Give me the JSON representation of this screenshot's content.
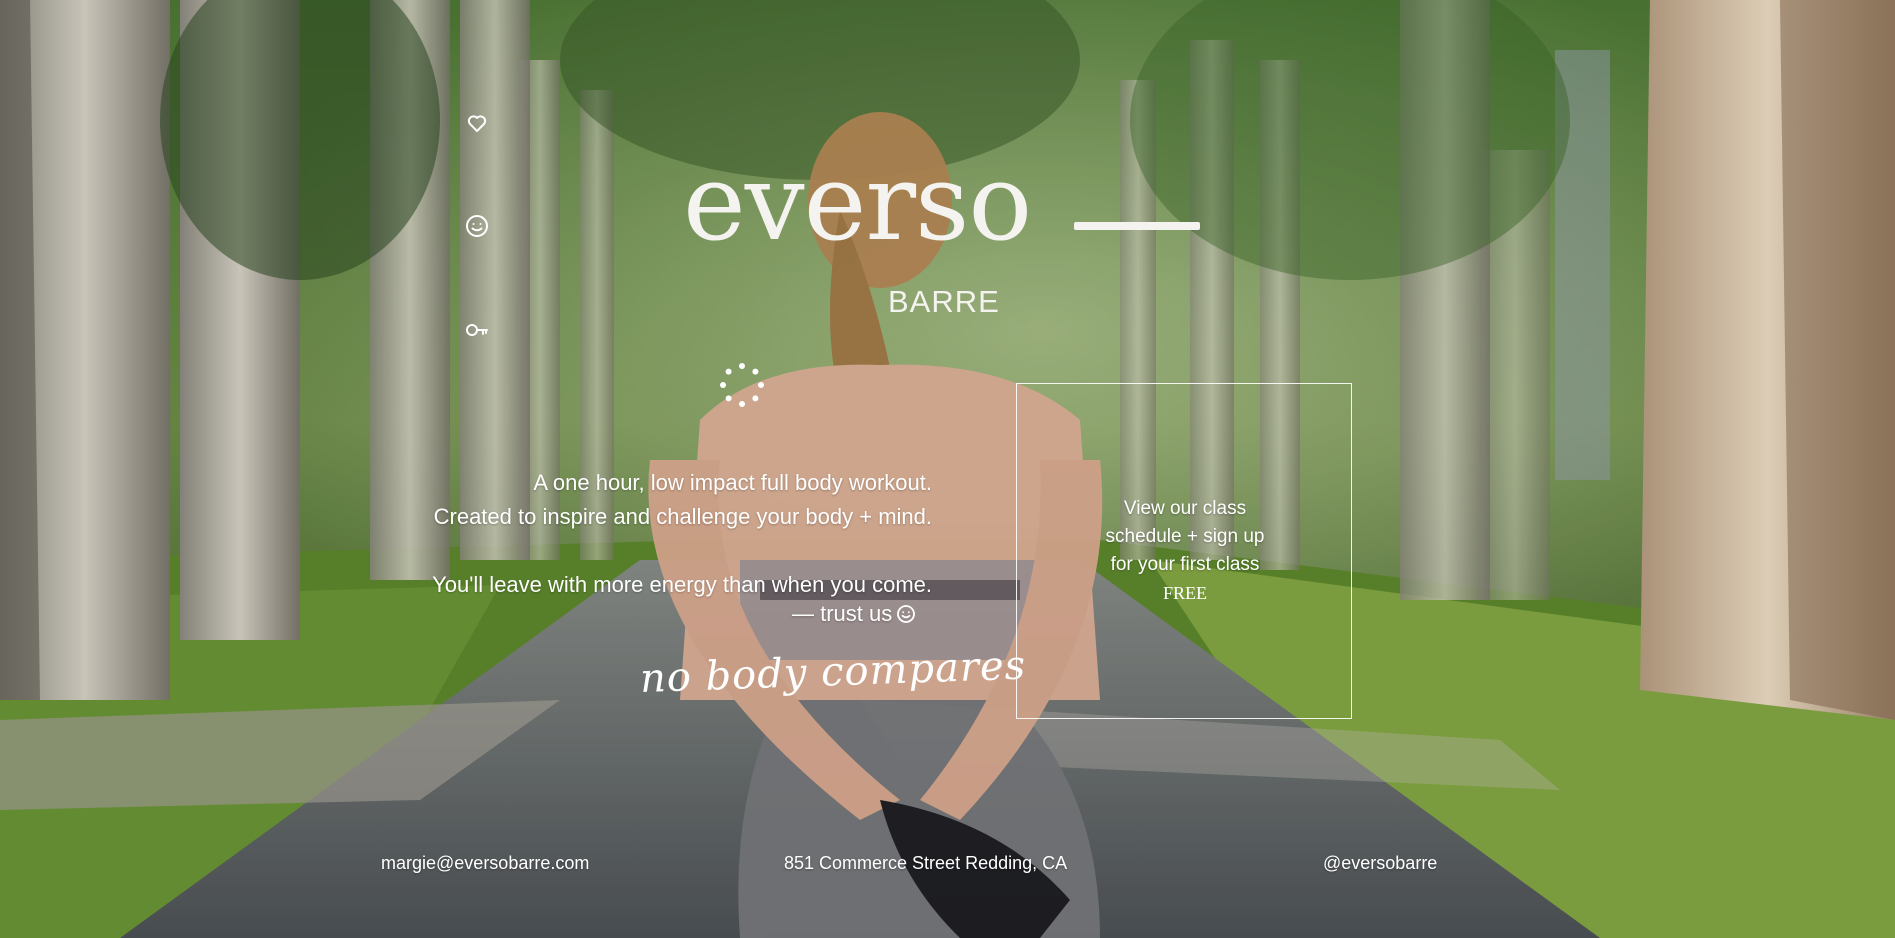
{
  "brand": {
    "name": "everso",
    "sub": "BARRE"
  },
  "sidebar": {
    "icons": [
      "heart-icon",
      "smiley-icon",
      "key-icon"
    ]
  },
  "tagline": {
    "line1": "A one hour, low impact full body workout.",
    "line2": "Created to inspire and challenge your body + mind.",
    "line3": "You'll leave with more energy than when you come.",
    "trust": "— trust us"
  },
  "script_text": "no body compares",
  "cta": {
    "line1": "View our class",
    "line2": "schedule + sign up",
    "line3": "for your first class",
    "free": "FREE"
  },
  "footer": {
    "email": "margie@eversobarre.com",
    "address": "851 Commerce Street Redding, CA",
    "social": "@eversobarre"
  },
  "colors": {
    "text": "#ffffff",
    "logo": "#f5f3ef",
    "foliage": "#3d5a2c",
    "road": "#5b5f63"
  }
}
